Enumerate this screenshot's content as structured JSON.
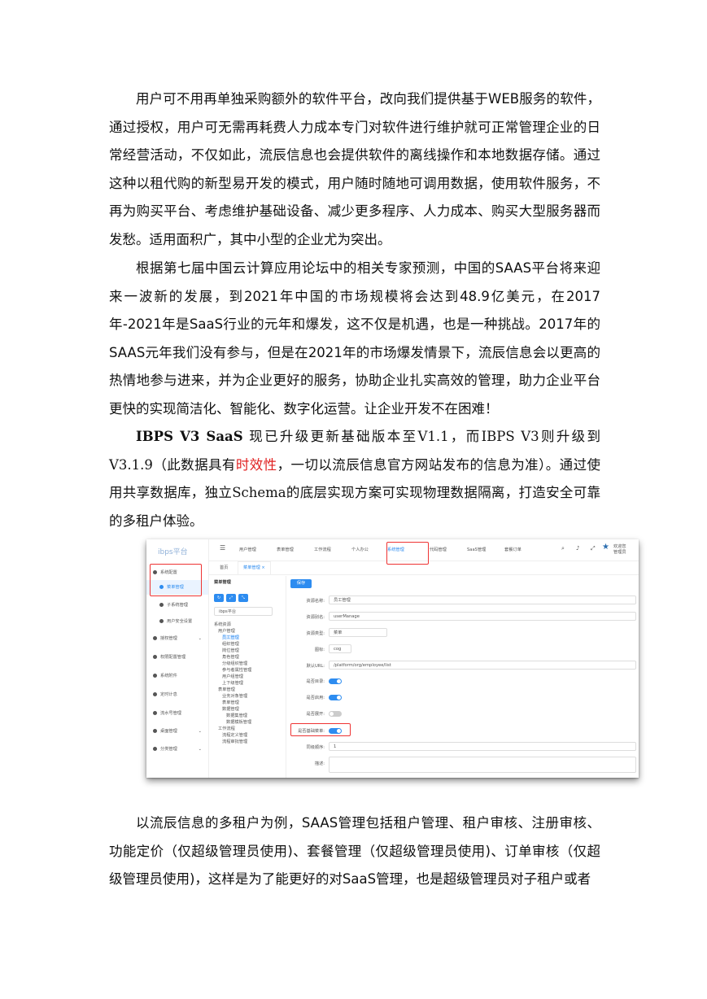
{
  "paragraphs": {
    "p1": "用户可不用再单独采购额外的软件平台，改向我们提供基于WEB服务的软件，通过授权，用户可无需再耗费人力成本专门对软件进行维护就可正常管理企业的日常经营活动，不仅如此，流辰信息也会提供软件的离线操作和本地数据存储。通过这种以租代购的新型易开发的模式，用户随时随地可调用数据，使用软件服务，不再为购买平台、考虑维护基础设备、减少更多程序、人力成本、购买大型服务器而发愁。适用面积广，其中小型的企业尤为突出。",
    "p2": "根据第七届中国云计算应用论坛中的相关专家预测，中国的SAAS平台将来迎来一波新的发展，到2021年中国的市场规模将会达到48.9亿美元，在2017年-2021年是SaaS行业的元年和爆发，这不仅是机遇，也是一种挑战。2017年的SAAS元年我们没有参与，但是在2021年的市场爆发情景下，流辰信息会以更高的热情地参与进来，并为企业更好的服务，协助企业扎实高效的管理，助力企业平台更快的实现简洁化、智能化、数字化运营。让企业开发不在困难！",
    "p3_a": "IBPS V3 SaaS",
    "p3_b": " 现已升级更新基础版本至V1.1，而IBPS V3则升级到V3.1.9（此数据具有",
    "p3_red": "时效性",
    "p3_c": "，一切以流辰信息官方网站发布的信息为准）。通过使用共享数据库，独立Schema的底层实现方案可实现物理数据隔离，打造安全可靠的多租户体验。",
    "p4": "以流辰信息的多租户为例，SAAS管理包括租户管理、租户审核、注册审核、功能定价（仅超级管理员使用)、套餐管理（仅超级管理员使用)、订单审核（仅超级管理员使用)，这样是为了能更好的对SaaS管理，也是超级管理员对子租户或者"
  },
  "screenshot": {
    "logo": "ibps平台",
    "sidebar": [
      "系统配置",
      "菜单管理",
      "子系统管理",
      "用户安全设置",
      "授权管理",
      "权限配置管理",
      "系统附件",
      "定时计息",
      "流水号管理",
      "桌面管理",
      "分类管理"
    ],
    "nav": [
      "用户管理",
      "表单管理",
      "工作流程",
      "个人办公",
      "系统管理",
      "代码管理",
      "SaaS管理",
      "套餐订单"
    ],
    "user": "欢迎您 管理员",
    "tabs": [
      "首页",
      "菜单管理 ×"
    ],
    "panel_title": "菜单管理",
    "tree_select": "ibps平台",
    "tree": [
      "系统资源",
      "用户管理",
      "员工管理",
      "组织管理",
      "岗位管理",
      "角色管理",
      "分级组织管理",
      "参与者属性管理",
      "用户组管理",
      "上下级管理",
      "表单管理",
      "业务对象管理",
      "表单管理",
      "数据管理",
      "数据集管理",
      "数据模板管理",
      "工作流程",
      "流程定义管理",
      "流程审批管理"
    ],
    "save_btn": "保存",
    "form_labels": [
      "资源名称:",
      "资源别名:",
      "资源类型:",
      "图标:",
      "默认URL:",
      "是否目录:",
      "是否启用:",
      "是否展开:",
      "是否基础菜单:",
      "同级顺序:",
      "描述:"
    ],
    "form_values": [
      "员工管理",
      "userManage",
      "菜单",
      "cog",
      "/platform/org/employee/list",
      "1"
    ]
  }
}
